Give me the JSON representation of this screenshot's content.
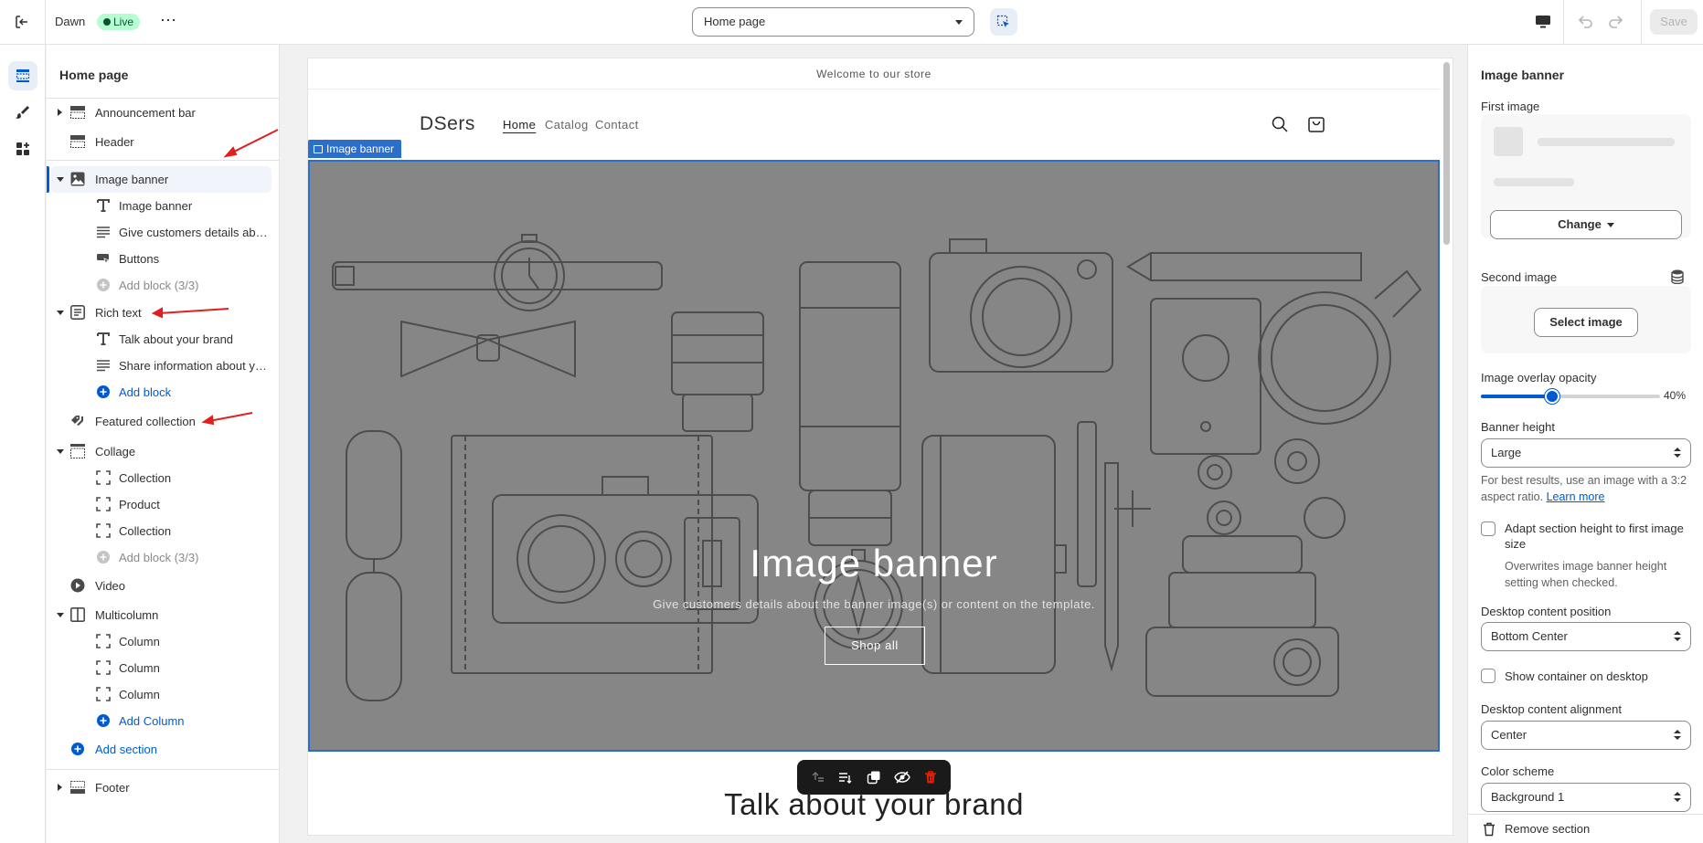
{
  "topbar": {
    "theme_name": "Dawn",
    "live_badge": "Live",
    "more_label": "⋯",
    "page_select": "Home page",
    "save_label": "Save"
  },
  "sidebar": {
    "title": "Home page",
    "rows": {
      "announcement_bar": "Announcement bar",
      "header": "Header",
      "image_banner": "Image banner",
      "image_banner_heading": "Image banner",
      "image_banner_text": "Give customers details about the banner image(s) or content on the template.",
      "image_banner_buttons": "Buttons",
      "image_banner_add_block": "Add block (3/3)",
      "rich_text": "Rich text",
      "rich_text_heading": "Talk about your brand",
      "rich_text_text": "Share information about your brand with your customers.",
      "rich_text_add_block": "Add block",
      "featured_collection": "Featured collection",
      "collage": "Collage",
      "collage_collection_1": "Collection",
      "collage_product": "Product",
      "collage_collection_2": "Collection",
      "collage_add_block": "Add block (3/3)",
      "video": "Video",
      "multicolumn": "Multicolumn",
      "column_1": "Column",
      "column_2": "Column",
      "column_3": "Column",
      "add_column": "Add Column",
      "add_section": "Add section",
      "footer": "Footer"
    }
  },
  "preview": {
    "announcement": "Welcome to our store",
    "logo": "DSers",
    "nav": [
      "Home",
      "Catalog",
      "Contact"
    ],
    "banner_tag": "Image banner",
    "banner_heading": "Image banner",
    "banner_text": "Give customers details about the banner image(s) or content on the template.",
    "banner_button": "Shop all",
    "rich_text_heading": "Talk about your brand"
  },
  "settings": {
    "title": "Image banner",
    "first_image_label": "First image",
    "change_label": "Change",
    "second_image_label": "Second image",
    "select_image_label": "Select image",
    "overlay_label": "Image overlay opacity",
    "overlay_value": "40%",
    "overlay_fraction": 0.4,
    "banner_height_label": "Banner height",
    "banner_height_value": "Large",
    "help_text": "For best results, use an image with a 3:2 aspect ratio.",
    "learn_more": "Learn more",
    "adapt_label": "Adapt section height to first image size",
    "adapt_help": "Overwrites image banner height setting when checked.",
    "desktop_position_label": "Desktop content position",
    "desktop_position_value": "Bottom Center",
    "show_container_label": "Show container on desktop",
    "desktop_alignment_label": "Desktop content alignment",
    "desktop_alignment_value": "Center",
    "color_scheme_label": "Color scheme",
    "color_scheme_value": "Background 1",
    "remove_section": "Remove section"
  },
  "colors": {
    "accent": "#005bd3",
    "banner_overlay": "#868686",
    "selection_outline": "#2c6ecb",
    "annotation": "#e02020"
  }
}
